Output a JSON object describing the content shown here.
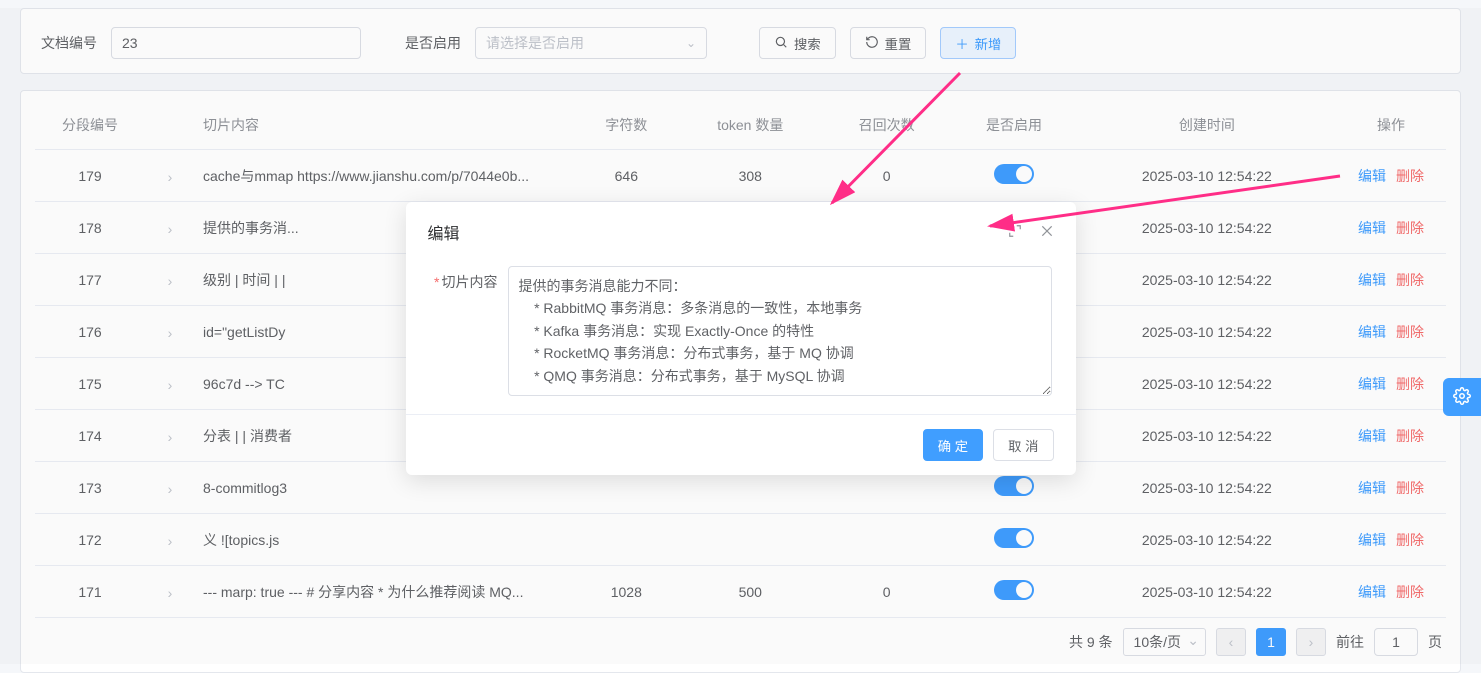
{
  "filters": {
    "doc_label": "文档编号",
    "doc_value": "23",
    "enable_label": "是否启用",
    "enable_placeholder": "请选择是否启用",
    "search_btn": "搜索",
    "reset_btn": "重置",
    "add_btn": "新增"
  },
  "table": {
    "headers": {
      "seg": "分段编号",
      "content": "切片内容",
      "chars": "字符数",
      "tokens": "token 数量",
      "recall": "召回次数",
      "enable": "是否启用",
      "created": "创建时间",
      "ops": "操作"
    },
    "rows": [
      {
        "seg": "179",
        "content": "cache与mmap https://www.jianshu.com/p/7044e0b...",
        "chars": "646",
        "tokens": "308",
        "recall": "0",
        "created": "2025-03-10 12:54:22"
      },
      {
        "seg": "178",
        "content": "提供的事务消...",
        "chars": "",
        "tokens": "",
        "recall": "",
        "created": "2025-03-10 12:54:22"
      },
      {
        "seg": "177",
        "content": "级别 | 时间 | |",
        "chars": "",
        "tokens": "",
        "recall": "",
        "created": "2025-03-10 12:54:22"
      },
      {
        "seg": "176",
        "content": "id=\"getListDy",
        "chars": "",
        "tokens": "",
        "recall": "",
        "created": "2025-03-10 12:54:22"
      },
      {
        "seg": "175",
        "content": "96c7d --> TC",
        "chars": "",
        "tokens": "",
        "recall": "",
        "created": "2025-03-10 12:54:22"
      },
      {
        "seg": "174",
        "content": "分表 | | 消费者",
        "chars": "",
        "tokens": "",
        "recall": "",
        "created": "2025-03-10 12:54:22"
      },
      {
        "seg": "173",
        "content": "8-commitlog3",
        "chars": "",
        "tokens": "",
        "recall": "",
        "created": "2025-03-10 12:54:22"
      },
      {
        "seg": "172",
        "content": "义 ![topics.js",
        "chars": "",
        "tokens": "",
        "recall": "",
        "created": "2025-03-10 12:54:22"
      },
      {
        "seg": "171",
        "content": "--- marp: true --- # 分享内容 * 为什么推荐阅读 MQ...",
        "chars": "1028",
        "tokens": "500",
        "recall": "0",
        "created": "2025-03-10 12:54:22"
      }
    ],
    "edit": "编辑",
    "delete": "删除"
  },
  "pagination": {
    "total": "共 9 条",
    "page_size": "10条/页",
    "current": "1",
    "goto_label": "前往",
    "goto_value": "1",
    "page_unit": "页"
  },
  "modal": {
    "title": "编辑",
    "field_label": "切片内容",
    "field_value": "提供的事务消息能力不同：\n    * RabbitMQ 事务消息：多条消息的一致性，本地事务\n    * Kafka 事务消息：实现 Exactly-Once 的特性\n    * RocketMQ 事务消息：分布式事务，基于 MQ 协调\n    * QMQ 事务消息：分布式事务，基于 MySQL 协调",
    "ok": "确 定",
    "cancel": "取 消"
  }
}
